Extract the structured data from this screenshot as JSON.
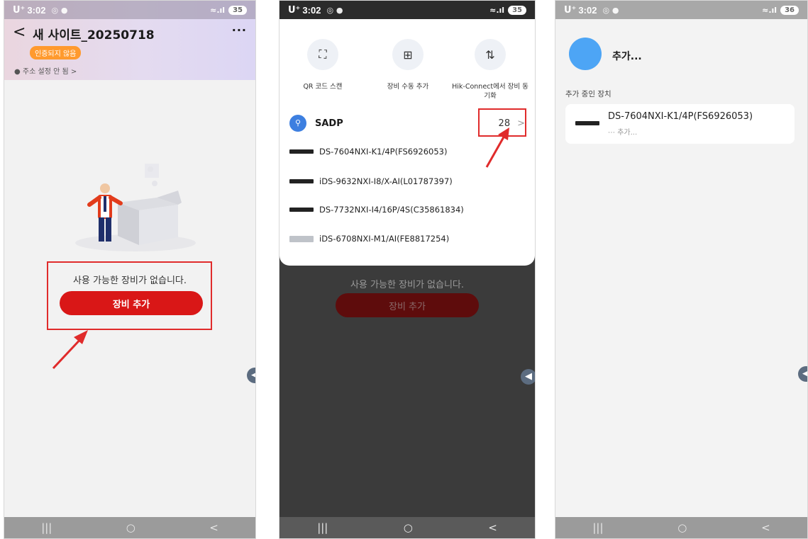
{
  "status_bar": {
    "time": "3:02",
    "carrier": "U⁺",
    "left_icons": "◎ ●",
    "signal": "≈.ıl",
    "battery_p1": "35",
    "battery_p2": "35",
    "battery_p3": "36"
  },
  "panel1": {
    "back_icon": "<",
    "site_title": "새 사이트_20250718",
    "more_icon": "···",
    "status_badge": "인증되지 않음",
    "address": "주소 설정 안 됨 >",
    "empty_message": "사용 가능한 장비가 없습니다.",
    "add_button": "장비 추가"
  },
  "panel2": {
    "quick_actions": [
      {
        "label": "QR 코드 스캔",
        "icon": "qr-scan-icon"
      },
      {
        "label": "장비 수동 추가",
        "icon": "manual-add-icon"
      },
      {
        "label": "Hik-Connect에서 장비 동기화",
        "icon": "sync-icon"
      }
    ],
    "sadp_label": "SADP",
    "sadp_count": "28",
    "devices": [
      "DS-7604NXI-K1/4P(FS6926053)",
      "iDS-9632NXI-I8/X-AI(L01787397)",
      "DS-7732NXI-I4/16P/4S(C35861834)",
      "iDS-6708NXI-M1/AI(FE8817254)"
    ],
    "empty_message": "사용 가능한 장비가 없습니다.",
    "add_button": "장비 추가"
  },
  "panel3": {
    "adding_title": "추가...",
    "section_title": "추가 중인 장치",
    "device_name": "DS-7604NXI-K1/4P(FS6926053)",
    "device_status": "추가..."
  },
  "nav_bar": {
    "recent": "|||",
    "home": "○",
    "back": "<"
  },
  "colors": {
    "accent_red": "#d91717",
    "highlight_box": "#e02b2b",
    "badge_orange": "#ff9a2e",
    "avatar_blue": "#4da5f5"
  }
}
